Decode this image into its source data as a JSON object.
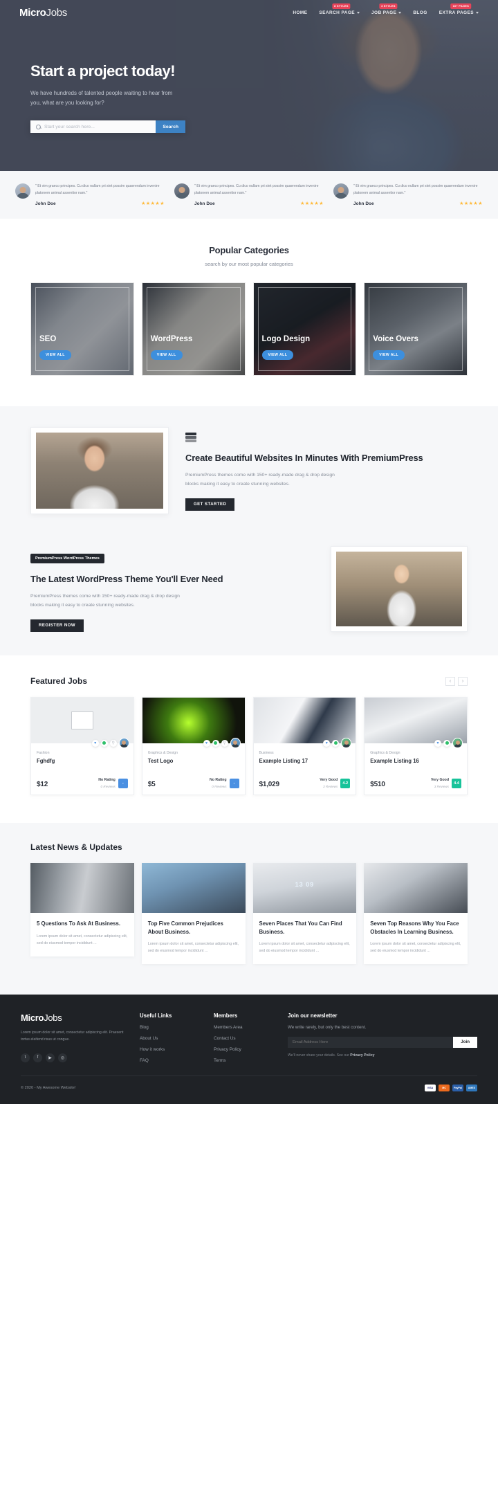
{
  "header": {
    "logo_main": "Micro",
    "logo_light": "Jobs",
    "nav": [
      {
        "label": "HOME",
        "badge": "",
        "caret": false
      },
      {
        "label": "SEARCH PAGE",
        "badge": "8 STYLES",
        "caret": true
      },
      {
        "label": "JOB PAGE",
        "badge": "3 STYLES",
        "caret": true
      },
      {
        "label": "BLOG",
        "badge": "",
        "caret": false
      },
      {
        "label": "EXTRA PAGES",
        "badge": "10+ PAGES",
        "caret": true
      }
    ]
  },
  "hero": {
    "title": "Start a project today!",
    "subtitle": "We have hundreds of talented people waiting to hear from you, what are you looking for?",
    "search_placeholder": "Start your search here...",
    "search_button": "Search"
  },
  "testimonials": [
    {
      "text": "\" Et vim graeco principes. Cu dico nullam pri stet possim quaerendum invenire platonem animal assentior nam.\"",
      "name": "John Doe",
      "stars": "★★★★★"
    },
    {
      "text": "\" Et vim graeco principes. Cu dico nullam pri stet possim quaerendum invenire platonem animal assentior nam.\"",
      "name": "John Doe",
      "stars": "★★★★★"
    },
    {
      "text": "\" Et vim graeco principes. Cu dico nullam pri stet possim quaerendum invenire platonem animal assentior nam.\"",
      "name": "John Doe",
      "stars": "★★★★★"
    }
  ],
  "categories_section": {
    "title": "Popular Categories",
    "subtitle": "search by our most popular categories",
    "items": [
      {
        "label": "SEO",
        "button": "VIEW ALL"
      },
      {
        "label": "WordPress",
        "button": "VIEW ALL"
      },
      {
        "label": "Logo Design",
        "button": "VIEW ALL"
      },
      {
        "label": "Voice Overs",
        "button": "VIEW ALL"
      }
    ]
  },
  "promo1": {
    "icon": "layers-icon",
    "title": "Create Beautiful Websites In Minutes With PremiumPress",
    "body": "PremiumPress themes come with 150+ ready-made drag & drop design blocks making it easy to create stunning websites.",
    "button": "GET STARTED"
  },
  "promo2": {
    "tag": "PremiumPress WordPress Themes",
    "title": "The Latest WordPress Theme You'll Ever Need",
    "body": "PremiumPress themes come with 150+ ready-made drag & drop design blocks making it easy to create stunning websites.",
    "button": "REGISTER NOW"
  },
  "featured_jobs": {
    "title": "Featured Jobs",
    "prev": "‹",
    "next": "›",
    "items": [
      {
        "category": "Fashion",
        "name": "Fghdfg",
        "price": "$12",
        "rating_text": "No Rating",
        "reviews": "0 Reviews",
        "score": "-",
        "score_color": "blue"
      },
      {
        "category": "Graphics & Design",
        "name": "Test Logo",
        "price": "$5",
        "rating_text": "No Rating",
        "reviews": "0 Reviews",
        "score": "-",
        "score_color": "blue"
      },
      {
        "category": "Business",
        "name": "Example Listing 17",
        "price": "$1,029",
        "rating_text": "Very Good",
        "reviews": "3 Reviews",
        "score": "4.2",
        "score_color": "green"
      },
      {
        "category": "Graphics & Design",
        "name": "Example Listing 16",
        "price": "$510",
        "rating_text": "Very Good",
        "reviews": "3 Reviews",
        "score": "4.4",
        "score_color": "green"
      }
    ]
  },
  "news": {
    "title": "Latest News & Updates",
    "posts": [
      {
        "title": "5 Questions To Ask At Business.",
        "excerpt": "Lorem ipsum dolor sit amet, consectetur adipiscing elit, sed do eiusmod tempor incididunt ..."
      },
      {
        "title": "Top Five Common Prejudices About Business.",
        "excerpt": "Lorem ipsum dolor sit amet, consectetur adipiscing elit, sed do eiusmod tempor incididunt ..."
      },
      {
        "title": "Seven Places That You Can Find Business.",
        "excerpt": "Lorem ipsum dolor sit amet, consectetur adipiscing elit, sed do eiusmod tempor incididunt ..."
      },
      {
        "title": "Seven Top Reasons Why You Face Obstacles In Learning Business.",
        "excerpt": "Lorem ipsum dolor sit amet, consectetur adipiscing elit, sed do eiusmod tempor incididunt ..."
      }
    ]
  },
  "footer": {
    "logo_main": "Micro",
    "logo_light": "Jobs",
    "about": "Lorem ipsum dolor sit amet, consectetur adipiscing elit. Praesent tortus eleifend risus ut congue.",
    "social": [
      "t",
      "f",
      "▶",
      "◎"
    ],
    "useful_links_title": "Useful Links",
    "useful_links": [
      "Blog",
      "About Us",
      "How it works",
      "FAQ"
    ],
    "members_title": "Members",
    "members": [
      "Members Area",
      "Contact Us",
      "Privacy Policy",
      "Terms"
    ],
    "newsletter_title": "Join our newsletter",
    "newsletter_sub": "We write rarely, but only the best content.",
    "newsletter_placeholder": "Email Address Here",
    "newsletter_button": "Join",
    "newsletter_note_a": "We'll never share your details. See our ",
    "newsletter_note_b": "Privacy Policy",
    "copyright": "© 2020 - My Awesome Website!",
    "payments": [
      "VISA",
      "MC",
      "PayPal",
      "AMEX"
    ]
  },
  "colors": {
    "accent_blue": "#3d8fdd",
    "badge_red": "#e8445a",
    "dark": "#1f2226",
    "green": "#18c39a"
  }
}
